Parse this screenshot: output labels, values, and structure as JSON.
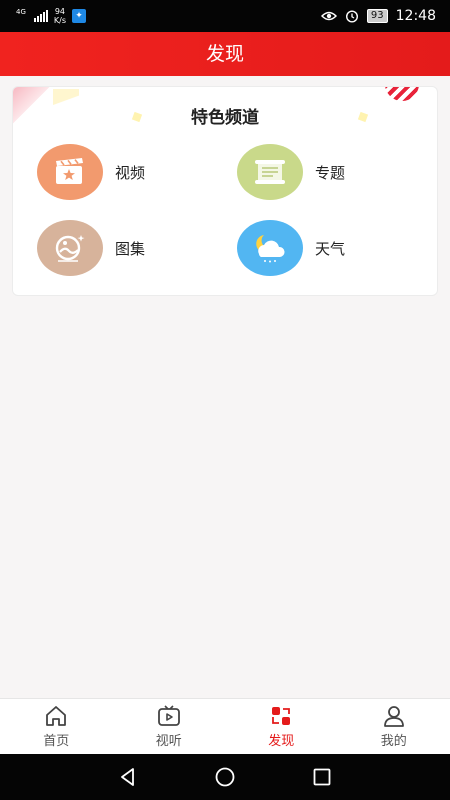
{
  "status_bar": {
    "network_tag": "4G",
    "speed_value": "94",
    "speed_unit": "K/s",
    "battery": "93",
    "time": "12:48",
    "icons": [
      "signal-icon",
      "app-notification-icon",
      "eye-comfort-icon",
      "alarm-icon",
      "battery-icon"
    ]
  },
  "title_bar": {
    "title": "发现"
  },
  "card": {
    "title": "特色频道",
    "channels": [
      {
        "label": "视频",
        "icon": "video-clapper-icon",
        "color": "#f29a6e"
      },
      {
        "label": "专题",
        "icon": "scroll-icon",
        "color": "#c9d98a"
      },
      {
        "label": "图集",
        "icon": "photo-gallery-icon",
        "color": "#d7b39b"
      },
      {
        "label": "天气",
        "icon": "weather-moon-cloud-icon",
        "color": "#52b6f2"
      }
    ]
  },
  "bottom_nav": {
    "items": [
      {
        "label": "首页",
        "icon": "home-icon",
        "active": false
      },
      {
        "label": "视听",
        "icon": "tv-play-icon",
        "active": false
      },
      {
        "label": "发现",
        "icon": "discover-icon",
        "active": true
      },
      {
        "label": "我的",
        "icon": "profile-icon",
        "active": false
      }
    ]
  },
  "system_nav": {
    "buttons": [
      "back-icon",
      "home-circle-icon",
      "recents-icon"
    ]
  },
  "colors": {
    "brand_red": "#e41b1b",
    "status_bar_bg": "#050505",
    "page_bg": "#f7f5f5"
  }
}
